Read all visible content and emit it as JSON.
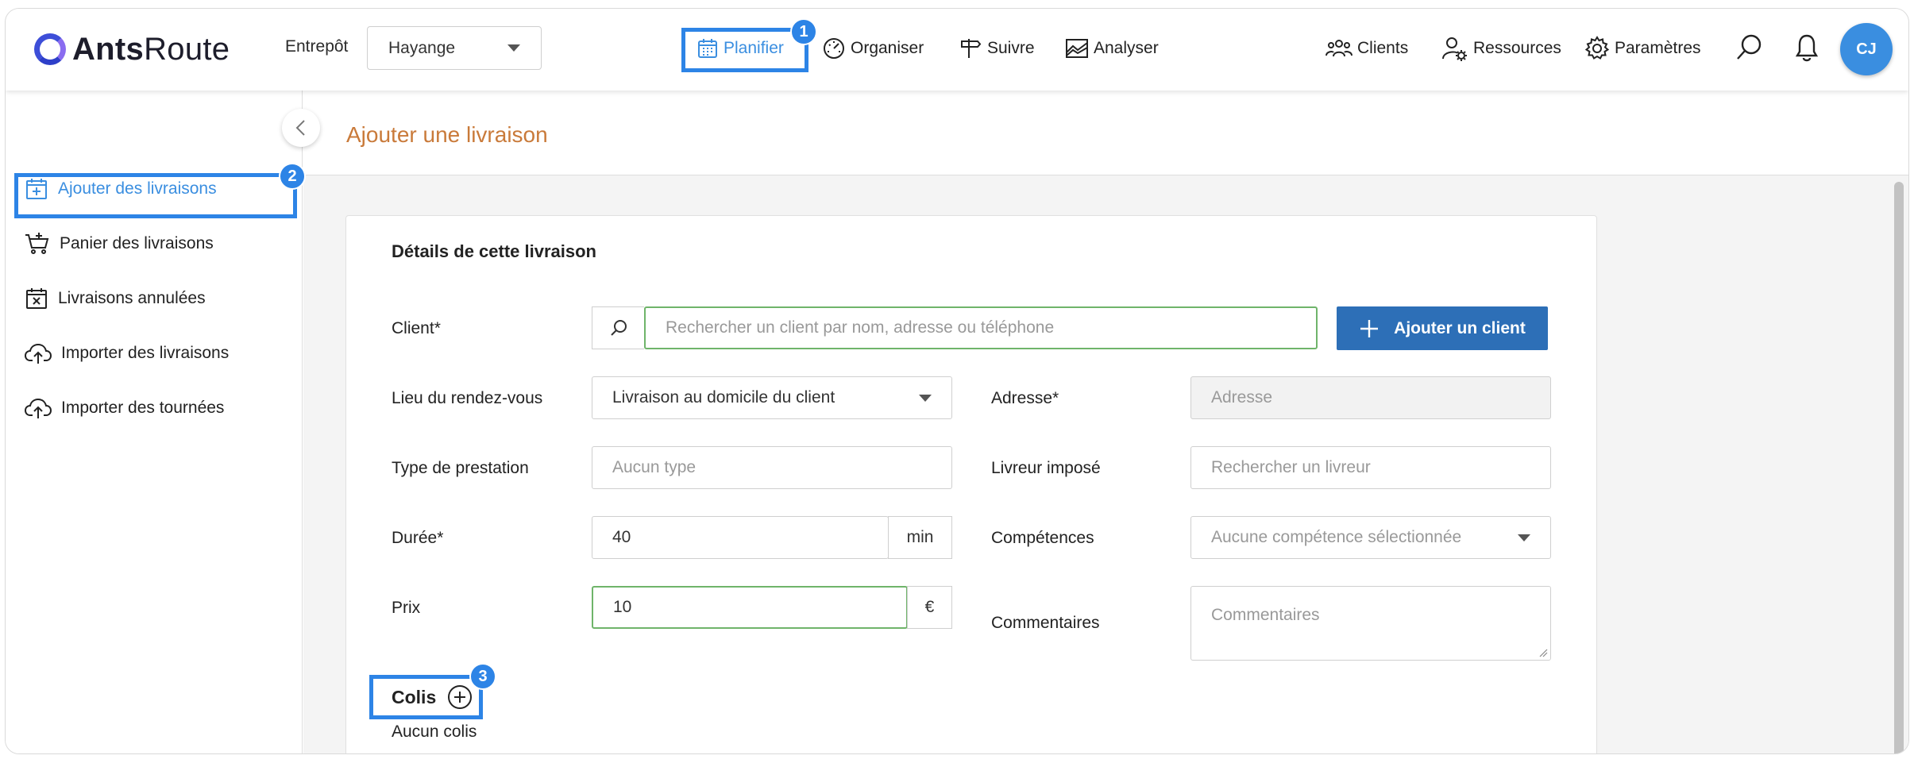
{
  "app": {
    "logo_bold": "Ants",
    "logo_light": "Route"
  },
  "header": {
    "warehouse_label": "Entrepôt",
    "warehouse_value": "Hayange",
    "nav": {
      "planifier": "Planifier",
      "organiser": "Organiser",
      "suivre": "Suivre",
      "analyser": "Analyser",
      "clients": "Clients",
      "ressources": "Ressources",
      "parametres": "Paramètres"
    },
    "avatar_initials": "CJ"
  },
  "callouts": {
    "one": "1",
    "two": "2",
    "three": "3"
  },
  "sidebar": {
    "items": [
      {
        "label": "Ajouter des livraisons"
      },
      {
        "label": "Panier des livraisons"
      },
      {
        "label": "Livraisons annulées"
      },
      {
        "label": "Importer des livraisons"
      },
      {
        "label": "Importer des tournées"
      }
    ]
  },
  "page": {
    "title": "Ajouter une livraison"
  },
  "form": {
    "section_title": "Détails de cette livraison",
    "client_label": "Client*",
    "client_placeholder": "Rechercher un client par nom, adresse ou téléphone",
    "add_client_label": "Ajouter un client",
    "meeting_label": "Lieu du rendez-vous",
    "meeting_value": "Livraison au domicile du client",
    "address_label": "Adresse*",
    "address_placeholder": "Adresse",
    "service_label": "Type de prestation",
    "service_placeholder": "Aucun type",
    "driver_label": "Livreur imposé",
    "driver_placeholder": "Rechercher un livreur",
    "duration_label": "Durée*",
    "duration_value": "40",
    "duration_unit": "min",
    "skills_label": "Compétences",
    "skills_value": "Aucune compétence sélectionnée",
    "price_label": "Prix",
    "price_value": "10",
    "price_unit": "€",
    "comments_label": "Commentaires",
    "comments_placeholder": "Commentaires",
    "colis_title": "Colis",
    "no_colis": "Aucun colis"
  },
  "colors": {
    "accent": "#3a8ee0",
    "callout": "#2d84e6",
    "primary_button": "#2d6fb7",
    "page_title": "#c97a3a",
    "focus_border": "#6fb46a"
  }
}
